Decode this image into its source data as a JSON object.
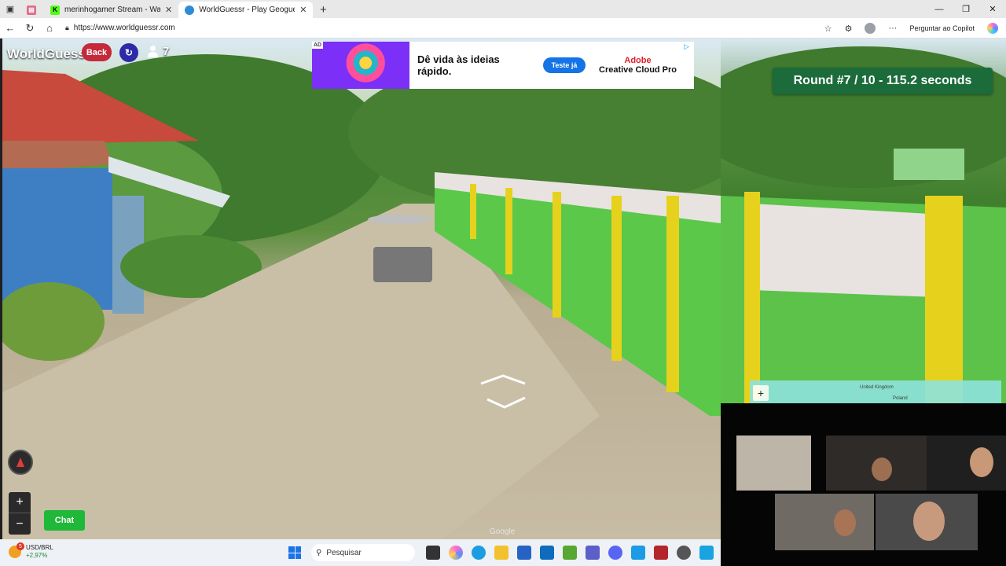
{
  "browser": {
    "tabs": [
      {
        "title": "merinhogamer Stream - Watch Li",
        "favicon": "kick-icon",
        "active": false
      },
      {
        "title": "WorldGuessr - Play Geoguessr fo",
        "favicon": "globe-icon",
        "active": true
      }
    ],
    "url": "https://www.worldguessr.com",
    "copilot_label": "Perguntar ao Copilot"
  },
  "game": {
    "logo": "WorldGuessr",
    "back_label": "Back",
    "players_count": "7",
    "round_text": "Round #7 / 10 - 115.2 seconds",
    "chat_label": "Chat",
    "zoom_in": "+",
    "zoom_out": "−",
    "google_mark": "Google"
  },
  "ad": {
    "tag": "AD",
    "headline": "Dê vida às ideias rápido.",
    "cta": "Teste já",
    "brand_line1": "Adobe",
    "brand_line2": "Creative Cloud Pro"
  },
  "minimap": {
    "plus": "+",
    "label_uk": "United Kingdom",
    "label_poland": "Poland"
  },
  "taskbar": {
    "ticker": "USD/BRL",
    "change": "+2,97%",
    "badge": "5",
    "search_placeholder": "Pesquisar"
  },
  "colors": {
    "round_bg": "#1c6b3a",
    "back_bg": "#c5293a",
    "chat_bg": "#1fb839",
    "refresh_bg": "#2d2aa8"
  }
}
